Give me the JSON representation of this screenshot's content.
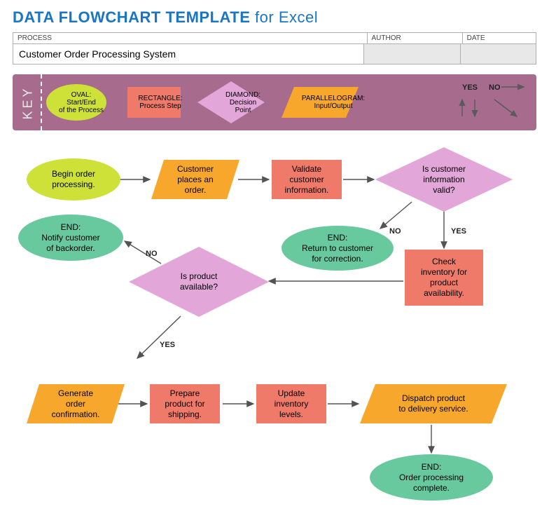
{
  "title_main": "DATA FLOWCHART TEMPLATE",
  "title_suffix": "for Excel",
  "header": {
    "process": "PROCESS",
    "author": "AUTHOR",
    "date": "DATE"
  },
  "process_name": "Customer Order Processing System",
  "author_value": "",
  "date_value": "",
  "key": {
    "label": "KEY",
    "oval": "OVAL:\nStart/End\nof the Process",
    "rect": "RECTANGLE:\nProcess Step",
    "diamond": "DIAMOND:\nDecision\nPoint",
    "para": "PARALLELOGRAM:\nInput/Output",
    "yes": "YES",
    "no": "NO"
  },
  "nodes": {
    "begin": "Begin order\nprocessing.",
    "customer_order": "Customer\nplaces an\norder.",
    "validate": "Validate\ncustomer\ninformation.",
    "is_valid": "Is customer\ninformation\nvalid?",
    "end_backorder": "END:\nNotify customer\nof backorder.",
    "end_return": "END:\nReturn to customer\nfor correction.",
    "is_avail": "Is product\navailable?",
    "check_inv": "Check\ninventory for\nproduct\navailability.",
    "gen_conf": "Generate\norder\nconfirmation.",
    "prepare": "Prepare\nproduct for\nshipping.",
    "update_inv": "Update\ninventory\nlevels.",
    "dispatch": "Dispatch product\nto delivery service.",
    "end_complete": "END:\nOrder processing\ncomplete."
  },
  "labels": {
    "yes": "YES",
    "no": "NO"
  }
}
